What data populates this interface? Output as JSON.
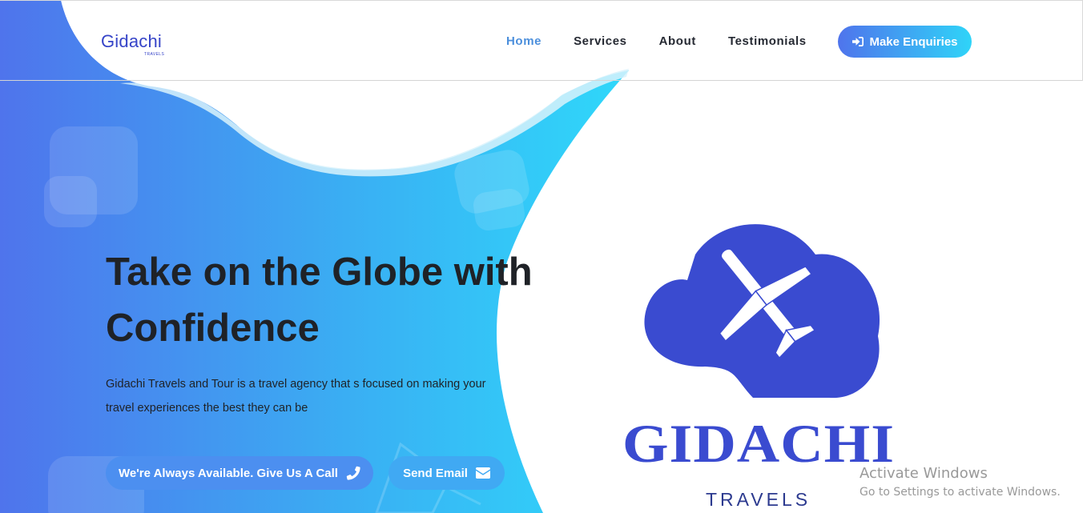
{
  "brand": {
    "name": "Gidachi",
    "sub": "TRAVELS"
  },
  "nav": {
    "items": [
      {
        "label": "Home",
        "active": true
      },
      {
        "label": "Services",
        "active": false
      },
      {
        "label": "About",
        "active": false
      },
      {
        "label": "Testimonials",
        "active": false
      }
    ],
    "cta_label": "Make Enquiries",
    "cta_icon": "sign-in-icon"
  },
  "hero": {
    "title_line1": "Take on the Globe with",
    "title_line2": "Confidence",
    "description": "Gidachi Travels and Tour is a travel agency that s focused on making your travel experiences the best they can be",
    "call_label": "We're Always Available. Give Us A Call",
    "call_icon": "phone-icon",
    "email_label": "Send Email",
    "email_icon": "envelope-icon"
  },
  "logo": {
    "word": "GIDACHI",
    "sub": "TRAVELS",
    "icon": "cloud-airplane-icon"
  },
  "watermark": {
    "title": "Activate Windows",
    "subtitle": "Go to Settings to activate Windows."
  },
  "colors": {
    "accent": "#4c8fdc",
    "gradient_start": "#4f74ec",
    "gradient_end": "#2fd4f8",
    "logo_blue": "#3a4bd0",
    "text_dark": "#1f2227"
  }
}
